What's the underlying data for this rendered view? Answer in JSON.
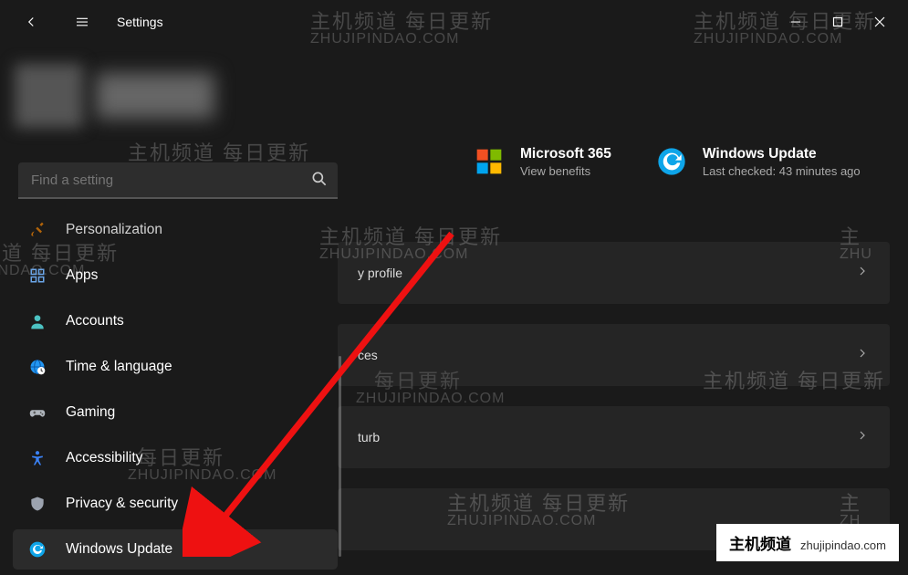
{
  "titlebar": {
    "title": "Settings"
  },
  "search": {
    "placeholder": "Find a setting"
  },
  "sidebar": {
    "items": [
      {
        "label": "Personalization"
      },
      {
        "label": "Apps"
      },
      {
        "label": "Accounts"
      },
      {
        "label": "Time & language"
      },
      {
        "label": "Gaming"
      },
      {
        "label": "Accessibility"
      },
      {
        "label": "Privacy & security"
      },
      {
        "label": "Windows Update"
      }
    ]
  },
  "tiles": {
    "ms365": {
      "title": "Microsoft 365",
      "sub": "View benefits"
    },
    "update": {
      "title": "Windows Update",
      "sub": "Last checked: 43 minutes ago"
    }
  },
  "content_rows": [
    {
      "label": "y profile"
    },
    {
      "label": "ces"
    },
    {
      "label": "turb"
    },
    {
      "label": ""
    }
  ],
  "footer": {
    "cn": "主机频道",
    "en": "zhujipindao.com"
  },
  "watermark": {
    "main": "主机频道 每日更新",
    "sub": "ZHUJIPINDAO.COM"
  }
}
